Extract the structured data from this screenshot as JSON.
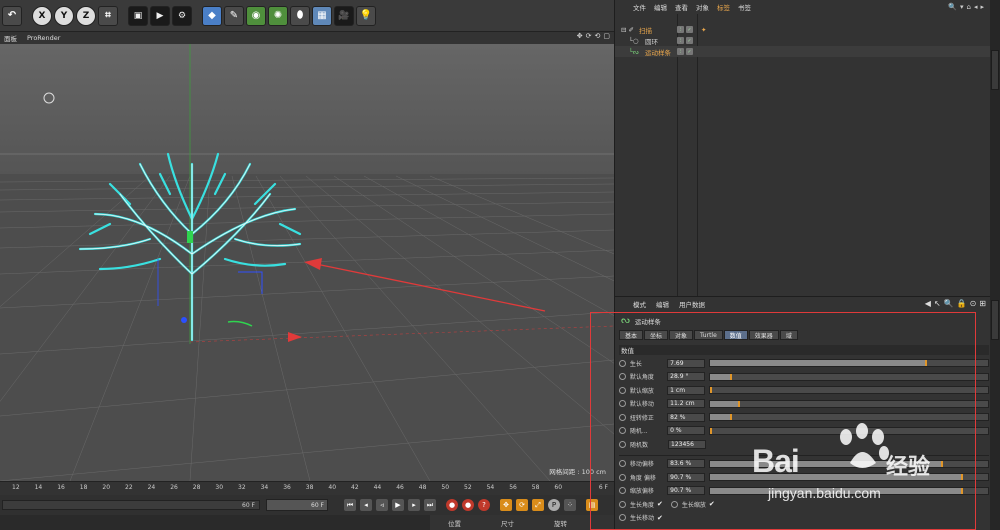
{
  "toolbar": {
    "axis_x": "X",
    "axis_y": "Y",
    "axis_z": "Z"
  },
  "viewport_menu": {
    "items": [
      "面板",
      "ProRender"
    ],
    "icons": [
      "move-view-icon",
      "rotate-view-icon",
      "zoom-view-icon",
      "maximize-view-icon"
    ]
  },
  "viewport": {
    "grid_spacing_label": "网格间距 : 100 cm"
  },
  "timeline": {
    "ticks": [
      "12",
      "14",
      "16",
      "18",
      "20",
      "22",
      "24",
      "26",
      "28",
      "30",
      "32",
      "34",
      "36",
      "38",
      "40",
      "42",
      "44",
      "46",
      "48",
      "50",
      "52",
      "54",
      "56",
      "58",
      "60"
    ],
    "end_frame": "6 F"
  },
  "playback": {
    "frame_left": "60 F",
    "frame_right": "60 F"
  },
  "coord_bar": {
    "position": "位置",
    "size": "尺寸",
    "rotation": "旋转"
  },
  "object_manager": {
    "menu": [
      "文件",
      "编辑",
      "查看",
      "对象",
      "标签",
      "书签"
    ],
    "active_menu": "标签",
    "objects": [
      {
        "name": "扫描",
        "color": "#e8a64c"
      },
      {
        "name": "圆环",
        "color": "#cfcfcf"
      },
      {
        "name": "运动样条",
        "color": "#e8a64c"
      }
    ]
  },
  "attributes": {
    "menu": [
      "模式",
      "编辑",
      "用户数据"
    ],
    "object_title": "运动样条",
    "tabs": [
      "基本",
      "坐标",
      "对象",
      "Turtle",
      "数值",
      "效果器",
      "域"
    ],
    "active_tab": "数值",
    "section": "数值",
    "params": [
      {
        "label": "生长",
        "value": "7.69",
        "fill": 0.78
      },
      {
        "label": "默认角度",
        "value": "28.9 °",
        "fill": 0.08
      },
      {
        "label": "默认缩放",
        "value": "1 cm",
        "fill": 0.01
      },
      {
        "label": "默认移动",
        "value": "11.2 cm",
        "fill": 0.11
      },
      {
        "label": "扭转修正",
        "value": "82 %",
        "fill": 0.08
      },
      {
        "label": "随机...",
        "value": "0 %",
        "fill": 0.0
      },
      {
        "label": "随机数",
        "value": "123456"
      }
    ],
    "params2": [
      {
        "label": "移动偏移",
        "value": "83.6 %",
        "fill": 0.84
      },
      {
        "label": "角度 偏移",
        "value": "90.7 %",
        "fill": 0.91
      },
      {
        "label": "缩放偏移",
        "value": "90.7 %",
        "fill": 0.91
      }
    ],
    "checks": {
      "grow_angle": "生长角度",
      "grow_scale": "生长缩放",
      "grow_move": "生长移动",
      "check_mark": "✔"
    }
  },
  "watermark": {
    "brand": "Bai",
    "brand_cn": "经验",
    "url": "jingyan.baidu.com"
  },
  "colors": {
    "accent_orange": "#e0962a",
    "highlight_red": "#e03a3a",
    "tree_cyan": "#39e0e0"
  }
}
